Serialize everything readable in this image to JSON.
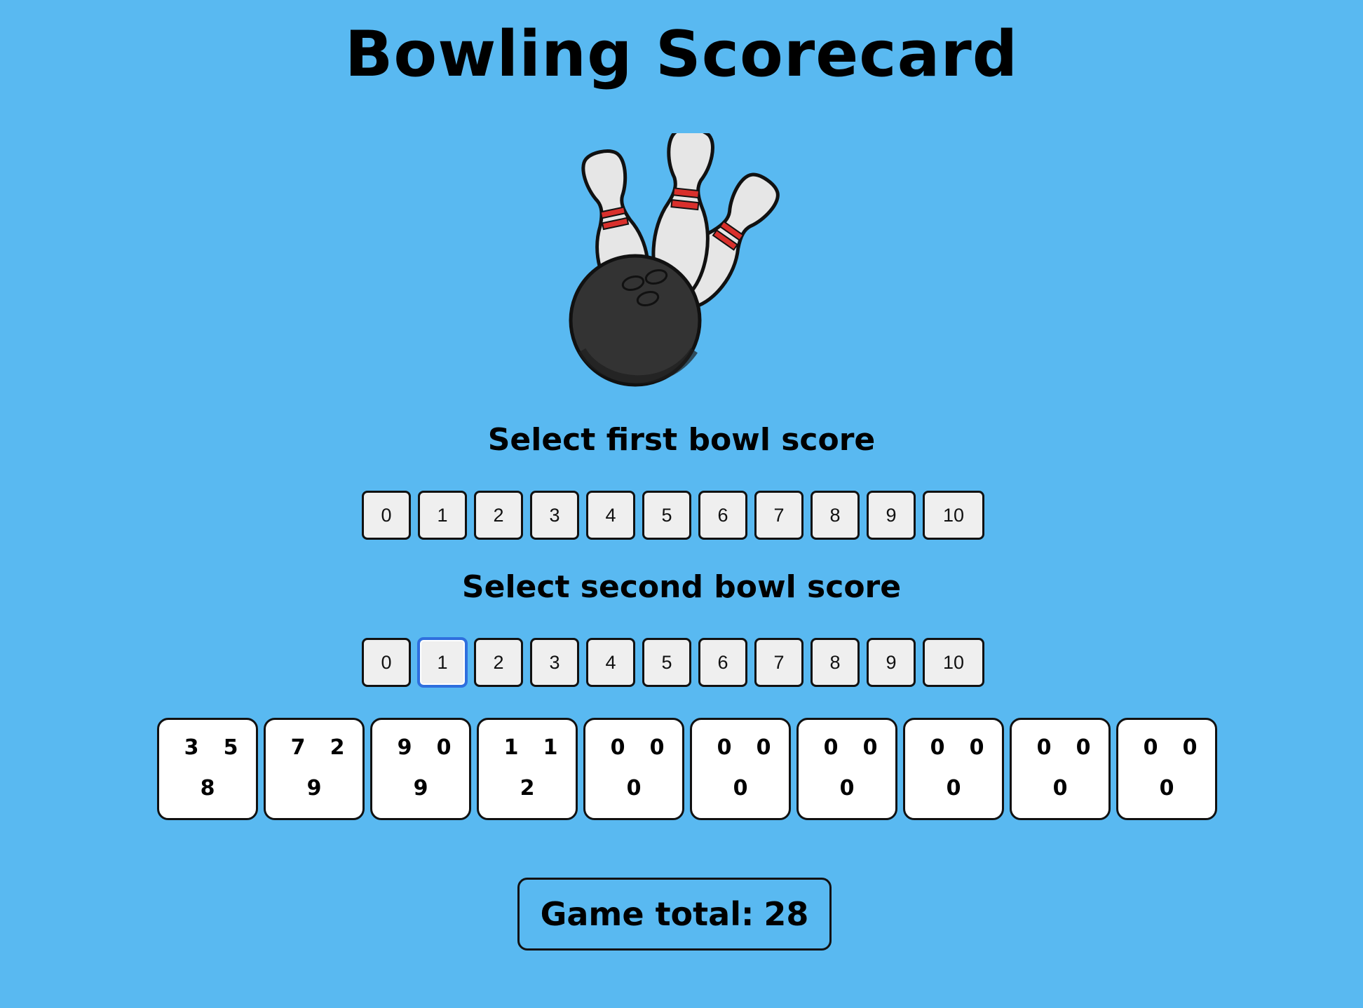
{
  "title": "Bowling Scorecard",
  "logo": {
    "icon": "bowling-ball-and-pins-icon"
  },
  "first_bowl": {
    "label": "Select first bowl score",
    "options": [
      "0",
      "1",
      "2",
      "3",
      "4",
      "5",
      "6",
      "7",
      "8",
      "9",
      "10"
    ]
  },
  "second_bowl": {
    "label": "Select second bowl score",
    "options": [
      "0",
      "1",
      "2",
      "3",
      "4",
      "5",
      "6",
      "7",
      "8",
      "9",
      "10"
    ],
    "focused_option": "1"
  },
  "frames": [
    {
      "first": "3",
      "second": "5",
      "total": "8"
    },
    {
      "first": "7",
      "second": "2",
      "total": "9"
    },
    {
      "first": "9",
      "second": "0",
      "total": "9"
    },
    {
      "first": "1",
      "second": "1",
      "total": "2"
    },
    {
      "first": "0",
      "second": "0",
      "total": "0"
    },
    {
      "first": "0",
      "second": "0",
      "total": "0"
    },
    {
      "first": "0",
      "second": "0",
      "total": "0"
    },
    {
      "first": "0",
      "second": "0",
      "total": "0"
    },
    {
      "first": "0",
      "second": "0",
      "total": "0"
    },
    {
      "first": "0",
      "second": "0",
      "total": "0"
    }
  ],
  "game_total": {
    "label": "Game total:",
    "value": "28"
  },
  "colors": {
    "background": "#59b9f1",
    "button_bg": "#efefef",
    "focus_ring": "#2f6fde",
    "pin_stripe": "#d9302c",
    "ball": "#333333"
  }
}
